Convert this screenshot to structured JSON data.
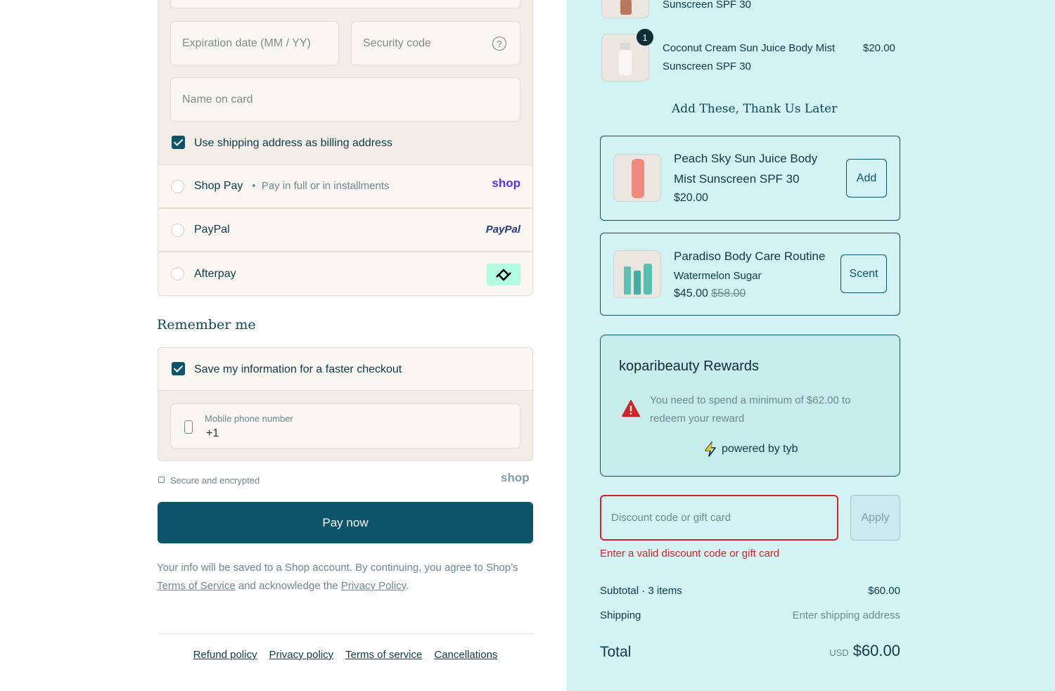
{
  "payment": {
    "expiration_placeholder": "Expiration date (MM / YY)",
    "security_placeholder": "Security code",
    "name_placeholder": "Name on card",
    "billing_checkbox_label": "Use shipping address as billing address",
    "methods": [
      {
        "label": "Shop Pay",
        "sub": "Pay in full or in installments",
        "logo": "shop"
      },
      {
        "label": "PayPal",
        "logo": "PayPal"
      },
      {
        "label": "Afterpay",
        "logo": "afterpay-icon"
      }
    ]
  },
  "remember": {
    "heading": "Remember me",
    "save_label": "Save my information for a faster checkout",
    "phone_label": "Mobile phone number",
    "phone_value": "+1"
  },
  "secure": {
    "text": "Secure and encrypted",
    "brand": "shop"
  },
  "pay_now": "Pay now",
  "legal": {
    "part1": "Your info will be saved to a Shop account. By continuing, you agree to Shop’s",
    "terms": "Terms of Service",
    "part2": "and acknowledge the",
    "privacy": "Privacy Policy",
    "end": "."
  },
  "footer_links": [
    "Refund policy",
    "Privacy policy",
    "Terms of service",
    "Cancellations"
  ],
  "cart": {
    "item_top_partial": "Sunscreen SPF 30",
    "item": {
      "qty": "1",
      "name_line1": "Coconut Cream Sun Juice Body Mist",
      "name_line2": "Sunscreen SPF 30",
      "price": "$20.00"
    }
  },
  "upsell": {
    "heading": "Add These, Thank Us Later",
    "items": [
      {
        "title_line1": "Peach Sky Sun Juice Body",
        "title_line2": "Mist Sunscreen SPF 30",
        "price": "$20.00",
        "button": "Add"
      },
      {
        "title_line1": "Paradiso Body Care Routine",
        "variant": "Watermelon Sugar",
        "price": "$45.00",
        "compare_price": "$58.00",
        "button": "Scent"
      }
    ]
  },
  "rewards": {
    "title": "koparibeauty Rewards",
    "message_line1": "You need to spend a minimum of $62.00 to",
    "message_line2": "redeem your reward",
    "powered": "powered by tyb"
  },
  "discount": {
    "placeholder": "Discount code or gift card",
    "apply": "Apply",
    "error": "Enter a valid discount code or gift card"
  },
  "summary": {
    "subtotal_label": "Subtotal · 3 items",
    "subtotal_value": "$60.00",
    "shipping_label": "Shipping",
    "shipping_value": "Enter shipping address",
    "total_label": "Total",
    "currency": "USD",
    "total_value": "$60.00"
  },
  "colors": {
    "primary": "#0b5469",
    "sidebar_bg": "#d3f2f3",
    "error": "#d1242a",
    "shop_purple": "#5a31f4",
    "afterpay_mint": "#b2fce4"
  }
}
